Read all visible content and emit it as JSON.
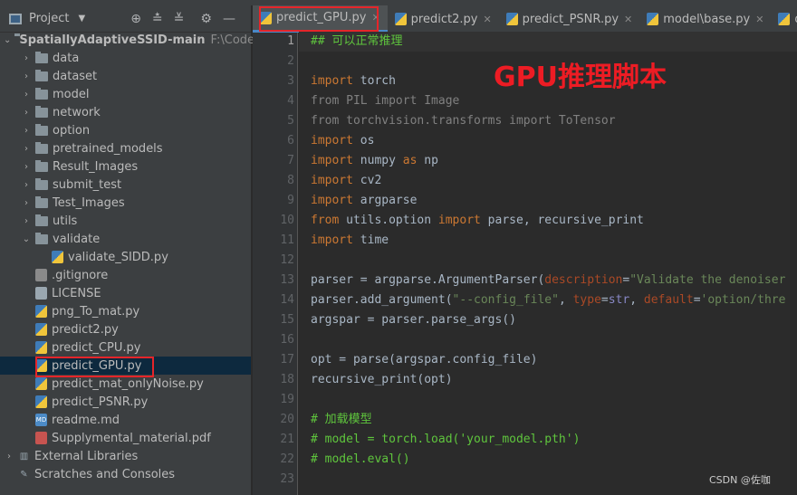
{
  "sidebar": {
    "title": "Project",
    "root": {
      "label": "SpatiallyAdaptiveSSID-main",
      "path": "F:\\Code\\Py"
    },
    "items": [
      {
        "label": "data",
        "type": "folder",
        "depth": 1
      },
      {
        "label": "dataset",
        "type": "folder",
        "depth": 1
      },
      {
        "label": "model",
        "type": "folder",
        "depth": 1
      },
      {
        "label": "network",
        "type": "folder",
        "depth": 1
      },
      {
        "label": "option",
        "type": "folder",
        "depth": 1
      },
      {
        "label": "pretrained_models",
        "type": "folder",
        "depth": 1
      },
      {
        "label": "Result_Images",
        "type": "folder",
        "depth": 1
      },
      {
        "label": "submit_test",
        "type": "folder",
        "depth": 1
      },
      {
        "label": "Test_Images",
        "type": "folder",
        "depth": 1
      },
      {
        "label": "utils",
        "type": "folder",
        "depth": 1
      },
      {
        "label": "validate",
        "type": "folder-open",
        "depth": 1
      },
      {
        "label": "validate_SIDD.py",
        "type": "py",
        "depth": 2
      },
      {
        "label": ".gitignore",
        "type": "git",
        "depth": 1
      },
      {
        "label": "LICENSE",
        "type": "txt",
        "depth": 1
      },
      {
        "label": "png_To_mat.py",
        "type": "py",
        "depth": 1
      },
      {
        "label": "predict2.py",
        "type": "py",
        "depth": 1
      },
      {
        "label": "predict_CPU.py",
        "type": "py",
        "depth": 1
      },
      {
        "label": "predict_GPU.py",
        "type": "py",
        "depth": 1,
        "selected": true
      },
      {
        "label": "predict_mat_onlyNoise.py",
        "type": "py",
        "depth": 1
      },
      {
        "label": "predict_PSNR.py",
        "type": "py",
        "depth": 1
      },
      {
        "label": "readme.md",
        "type": "md",
        "depth": 1
      },
      {
        "label": "Supplymental_material.pdf",
        "type": "pdf",
        "depth": 1
      },
      {
        "label": "External Libraries",
        "type": "lib",
        "depth": 0
      },
      {
        "label": "Scratches and Consoles",
        "type": "scratch",
        "depth": 0
      }
    ]
  },
  "tabs": [
    {
      "label": "predict_GPU.py",
      "active": true
    },
    {
      "label": "predict2.py"
    },
    {
      "label": "predict_PSNR.py"
    },
    {
      "label": "model\\base.py"
    },
    {
      "label": "datase"
    }
  ],
  "editor": {
    "current_line": 1,
    "lines": [
      [
        [
          "## 可以正常推理",
          "cm"
        ]
      ],
      [],
      [
        [
          "import",
          "kw"
        ],
        [
          " torch",
          ""
        ]
      ],
      [
        [
          "from PIL import Image",
          "dim"
        ]
      ],
      [
        [
          "from torchvision.transforms import ToTensor",
          "dim"
        ]
      ],
      [
        [
          "import",
          "kw"
        ],
        [
          " os",
          ""
        ]
      ],
      [
        [
          "import",
          "kw"
        ],
        [
          " numpy ",
          ""
        ],
        [
          "as",
          "kw"
        ],
        [
          " np",
          ""
        ]
      ],
      [
        [
          "import",
          "kw"
        ],
        [
          " cv2",
          ""
        ]
      ],
      [
        [
          "import",
          "kw"
        ],
        [
          " argparse",
          ""
        ]
      ],
      [
        [
          "from",
          "kw"
        ],
        [
          " utils.option ",
          ""
        ],
        [
          "import",
          "kw"
        ],
        [
          " parse, recursive_print",
          ""
        ]
      ],
      [
        [
          "import",
          "kw"
        ],
        [
          " time",
          ""
        ]
      ],
      [],
      [
        [
          "parser = argparse.ArgumentParser(",
          ""
        ],
        [
          "description",
          "par"
        ],
        [
          "=",
          ""
        ],
        [
          "\"Validate the denoiser",
          "str"
        ]
      ],
      [
        [
          "parser.add_argument(",
          ""
        ],
        [
          "\"--config_file\"",
          "str"
        ],
        [
          ", ",
          ""
        ],
        [
          "type",
          "par"
        ],
        [
          "=",
          ""
        ],
        [
          "str",
          "bi"
        ],
        [
          ", ",
          ""
        ],
        [
          "default",
          "par"
        ],
        [
          "=",
          ""
        ],
        [
          "'option/thre",
          "str"
        ]
      ],
      [
        [
          "argspar = parser.parse_args()",
          ""
        ]
      ],
      [],
      [
        [
          "opt = parse(argspar.config_file)",
          ""
        ]
      ],
      [
        [
          "recursive_print(opt)",
          ""
        ]
      ],
      [],
      [
        [
          "# 加载模型",
          "cm"
        ]
      ],
      [
        [
          "# model = torch.load('your_model.pth')",
          "cm"
        ]
      ],
      [
        [
          "# model.eval()",
          "cm"
        ]
      ],
      []
    ]
  },
  "annotation": "GPU推理脚本",
  "watermark": "CSDN @佐咖",
  "colors": {
    "highlight_box": "#e5252a",
    "keyword": "#cc7832",
    "comment": "#5fc53d",
    "string": "#6a8759"
  }
}
